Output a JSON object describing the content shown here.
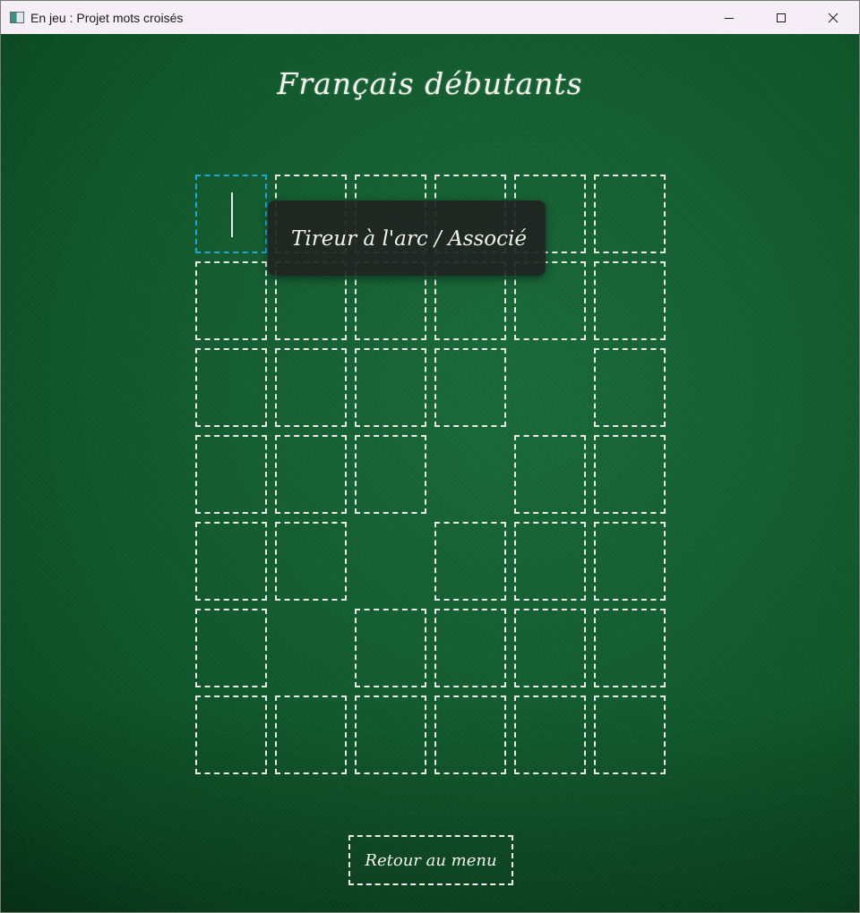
{
  "window": {
    "title": "En jeu : Projet mots croisés",
    "controls": {
      "minimize": "minimize-icon",
      "maximize": "maximize-icon",
      "close": "close-icon"
    }
  },
  "game": {
    "title": "Français débutants",
    "tooltip": "Tireur à l'arc / Associé",
    "back_button": "Retour au menu",
    "active_cell": [
      0,
      0
    ],
    "grid_rows": 7,
    "grid_cols": 6,
    "grid": [
      [
        1,
        1,
        1,
        1,
        1,
        1
      ],
      [
        1,
        1,
        1,
        1,
        1,
        1
      ],
      [
        1,
        1,
        1,
        1,
        0,
        1
      ],
      [
        1,
        1,
        1,
        0,
        1,
        1
      ],
      [
        1,
        1,
        0,
        1,
        1,
        1
      ],
      [
        1,
        0,
        1,
        1,
        1,
        1
      ],
      [
        1,
        1,
        1,
        1,
        1,
        1
      ]
    ]
  },
  "colors": {
    "board": "#135c30",
    "chalk": "#e9ece6",
    "active_border": "#21a6d6",
    "tooltip_bg": "#202422"
  }
}
